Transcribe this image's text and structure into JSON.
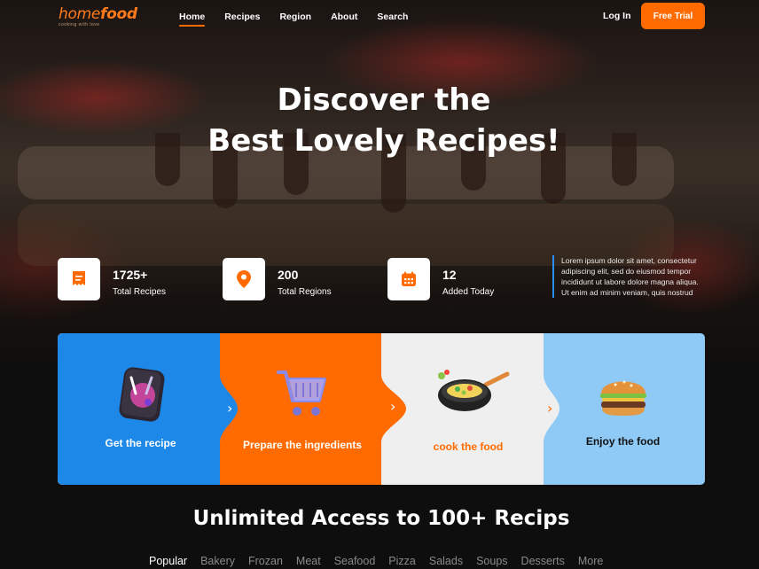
{
  "brand": {
    "logo_light": "home",
    "logo_bold": "food",
    "tagline": "cooking with love"
  },
  "nav": {
    "links": [
      {
        "label": "Home",
        "active": true
      },
      {
        "label": "Recipes",
        "active": false
      },
      {
        "label": "Region",
        "active": false
      },
      {
        "label": "About",
        "active": false
      },
      {
        "label": "Search",
        "active": false
      }
    ],
    "login": "Log In",
    "cta": "Free Trial"
  },
  "hero": {
    "headline_line1": "Discover the",
    "headline_line2": "Best Lovely Recipes!"
  },
  "stats": [
    {
      "icon": "receipt-icon",
      "value": "1725+",
      "label": "Total Recipes"
    },
    {
      "icon": "location-pin-icon",
      "value": "200",
      "label": "Total Regions"
    },
    {
      "icon": "calendar-icon",
      "value": "12",
      "label": "Added Today"
    }
  ],
  "description": "Lorem ipsum dolor sit amet, consectetur adipiscing elit, sed do eiusmod tempor incididunt ut labore dolore magna aliqua. Ut enim ad minim veniam, quis nostrud",
  "steps": [
    {
      "label": "Get the recipe",
      "icon": "recipe-book-icon"
    },
    {
      "label": "Prepare the ingredients",
      "icon": "shopping-cart-icon"
    },
    {
      "label": "cook the food",
      "icon": "frying-pan-icon"
    },
    {
      "label": "Enjoy the food",
      "icon": "burger-icon"
    }
  ],
  "colors": {
    "accent": "#ff6b00",
    "blue": "#1e88e8",
    "light_blue": "#8fcaf7",
    "light_gray": "#efefef"
  },
  "section": {
    "title": "Unlimited Access to 100+ Recips",
    "categories": [
      "Popular",
      "Bakery",
      "Frozan",
      "Meat",
      "Seafood",
      "Pizza",
      "Salads",
      "Soups",
      "Desserts",
      "More"
    ]
  }
}
